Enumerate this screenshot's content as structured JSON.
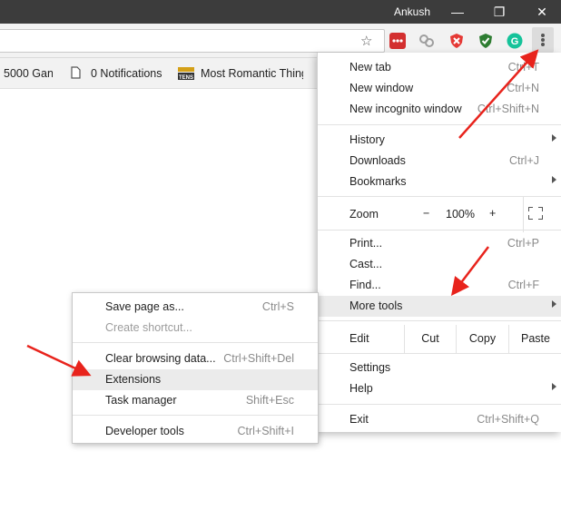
{
  "titlebar": {
    "user": "Ankush",
    "minimize_glyph": "—",
    "restore_glyph": "❐",
    "close_glyph": "✕"
  },
  "toolbar": {
    "star_glyph": "☆",
    "extensions": [
      {
        "name": "lastpass-icon",
        "color": "#d32f2f"
      },
      {
        "name": "link-icon",
        "color": "#9e9e9e"
      },
      {
        "name": "shield-red-icon",
        "color": "#e53935"
      },
      {
        "name": "shield-green-icon",
        "color": "#2e7d32"
      },
      {
        "name": "grammarly-icon",
        "color": "#15c39a"
      }
    ]
  },
  "bookmarks": [
    {
      "label": "5000 Gan",
      "icon": "page-icon"
    },
    {
      "label": "0 Notifications",
      "icon": "page-icon"
    },
    {
      "label": "Most Romantic Thing",
      "icon": "tens-icon"
    }
  ],
  "menu": {
    "new_tab": {
      "label": "New tab",
      "shortcut": "Ctrl+T"
    },
    "new_window": {
      "label": "New window",
      "shortcut": "Ctrl+N"
    },
    "new_incognito": {
      "label": "New incognito window",
      "shortcut": "Ctrl+Shift+N"
    },
    "history": {
      "label": "History"
    },
    "downloads": {
      "label": "Downloads",
      "shortcut": "Ctrl+J"
    },
    "bookmarks": {
      "label": "Bookmarks"
    },
    "zoom": {
      "label": "Zoom",
      "minus": "−",
      "value": "100%",
      "plus": "+"
    },
    "print": {
      "label": "Print...",
      "shortcut": "Ctrl+P"
    },
    "cast": {
      "label": "Cast..."
    },
    "find": {
      "label": "Find...",
      "shortcut": "Ctrl+F"
    },
    "more_tools": {
      "label": "More tools"
    },
    "edit": {
      "label": "Edit",
      "cut": "Cut",
      "copy": "Copy",
      "paste": "Paste"
    },
    "settings": {
      "label": "Settings"
    },
    "help": {
      "label": "Help"
    },
    "exit": {
      "label": "Exit",
      "shortcut": "Ctrl+Shift+Q"
    }
  },
  "submenu": {
    "save_page": {
      "label": "Save page as...",
      "shortcut": "Ctrl+S"
    },
    "create_shortcut": {
      "label": "Create shortcut..."
    },
    "clear_data": {
      "label": "Clear browsing data...",
      "shortcut": "Ctrl+Shift+Del"
    },
    "extensions": {
      "label": "Extensions"
    },
    "task_manager": {
      "label": "Task manager",
      "shortcut": "Shift+Esc"
    },
    "dev_tools": {
      "label": "Developer tools",
      "shortcut": "Ctrl+Shift+I"
    }
  },
  "colors": {
    "annotation_arrow": "#e8231c",
    "highlight": "#ebebeb",
    "titlebar": "#3c3c3c"
  }
}
